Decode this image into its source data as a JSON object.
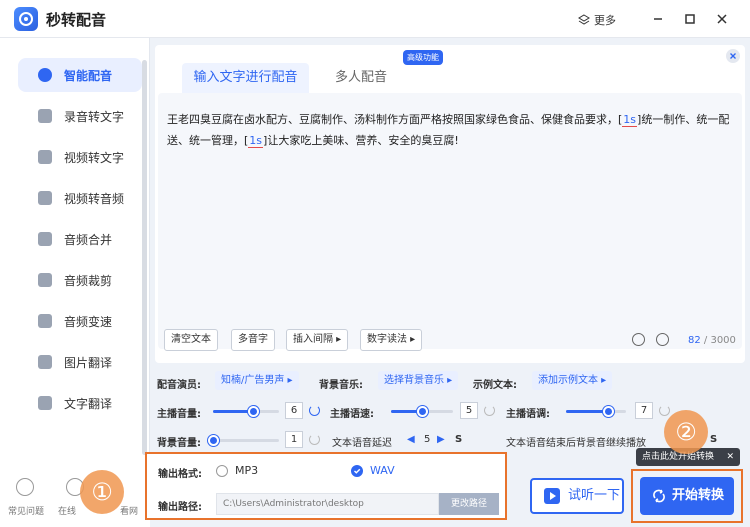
{
  "app": {
    "title": "秒转配音",
    "more": "更多"
  },
  "sidebar": {
    "items": [
      {
        "label": "智能配音",
        "active": true
      },
      {
        "label": "录音转文字"
      },
      {
        "label": "视频转文字"
      },
      {
        "label": "视频转音频"
      },
      {
        "label": "音频合并"
      },
      {
        "label": "音频裁剪"
      },
      {
        "label": "音频变速"
      },
      {
        "label": "图片翻译"
      },
      {
        "label": "文字翻译"
      }
    ],
    "bottom": [
      "常见问题",
      "在线",
      "看网"
    ]
  },
  "tabs": {
    "input": "输入文字进行配音",
    "multi": "多人配音",
    "badge": "高级功能"
  },
  "editor": {
    "p1": "王老四臭豆腐在卤水配方、豆腐制作、汤料制作方面严格按照国家绿色食品、保健食品要求，",
    "tag1": "1s",
    "p2": "统一制作、统一配送、统一管理，",
    "tag2": "1s",
    "p3": "让大家吃上美味、营养、安全的臭豆腐!",
    "tools": [
      "清空文本",
      "多音字",
      "插入间隔 ▸",
      "数字读法 ▸"
    ],
    "count_current": "82",
    "count_total": " / 3000"
  },
  "controls": {
    "actor_label": "配音演员:",
    "actor_value": "知楠/广告男声 ▸",
    "bgm_label": "背景音乐:",
    "bgm_value": "选择背景音乐 ▸",
    "sample_label": "示例文本:",
    "sample_value": "添加示例文本 ▸",
    "volume_label": "主播音量:",
    "volume_value": "6",
    "volume": 0.6,
    "speed_label": "主播语速:",
    "speed_value": "5",
    "speed": 0.5,
    "pitch_label": "主播语调:",
    "pitch_value": "7",
    "pitch": 0.7,
    "bgvol_label": "背景音量:",
    "bgvol_value": "1",
    "bgvol": 0.0,
    "delay_label": "文本语音延迟",
    "delay_value": "5",
    "delay_unit": "S",
    "after_label": "文本语音结束后背景音继续播放",
    "after_unit": "S"
  },
  "output": {
    "format_label": "输出格式:",
    "mp3": "MP3",
    "wav": "WAV",
    "path_label": "输出路径:",
    "path_value": "C:\\Users\\Administrator\\desktop",
    "change_path": "更改路径"
  },
  "actions": {
    "trial": "试听一下",
    "start": "开始转换",
    "tooltip": "点击此处开始转换",
    "step1": "①",
    "step2": "②"
  },
  "colors": {
    "accent": "#2f66f2",
    "highlight": "#e8732c"
  }
}
